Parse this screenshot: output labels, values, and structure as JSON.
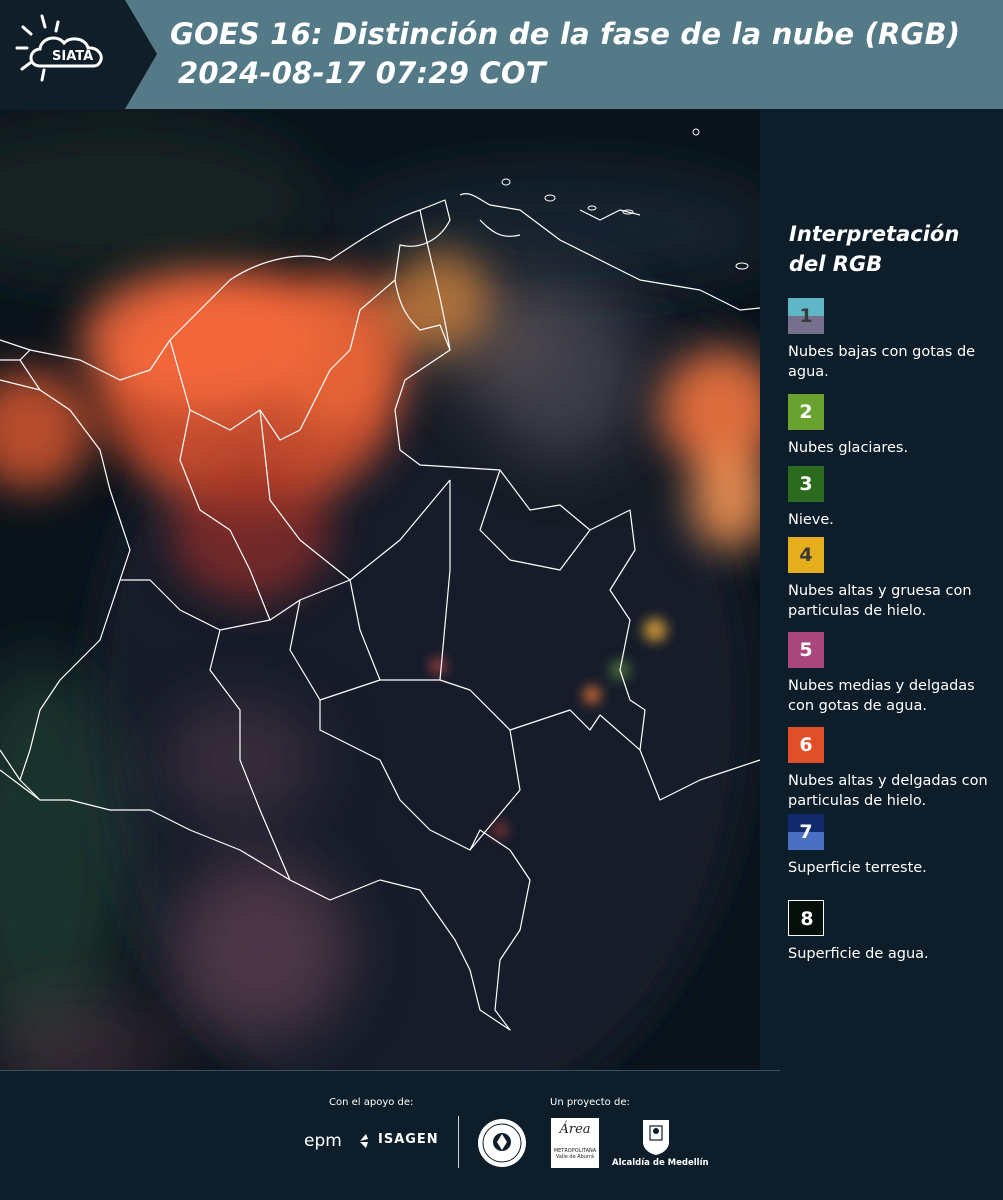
{
  "header": {
    "logo_text": "SIATA",
    "title_line1": "GOES 16: Distinción de la fase de la nube (RGB)",
    "title_line2": "2024-08-17 07:29 COT",
    "background_color": "#557a87"
  },
  "legend": {
    "title_line1": "Interpretación",
    "title_line2": "del RGB",
    "items": [
      {
        "number": "1",
        "label": "Nubes bajas con gotas de agua.",
        "color_top": "#5fb6c7",
        "color_bottom": "#77708c"
      },
      {
        "number": "2",
        "label": "Nubes glaciares.",
        "color_top": "#6aa22f",
        "color_bottom": "#6aa22f"
      },
      {
        "number": "3",
        "label": "Nieve.",
        "color_top": "#2c6a1e",
        "color_bottom": "#2c6a1e"
      },
      {
        "number": "4",
        "label": "Nubes altas y gruesa con particulas de hielo.",
        "color_top": "#e5ae1d",
        "color_bottom": "#e5ae1d"
      },
      {
        "number": "5",
        "label": "Nubes medias y delgadas con gotas de agua.",
        "color_top": "#a9467b",
        "color_bottom": "#a9467b"
      },
      {
        "number": "6",
        "label": "Nubes altas y delgadas con particulas de hielo.",
        "color_top": "#e04f27",
        "color_bottom": "#e04f27"
      },
      {
        "number": "7",
        "label": "Superficie terreste.",
        "color_top": "#112a6b",
        "color_bottom": "#4a6fc3"
      },
      {
        "number": "8",
        "label": "Superficie de agua.",
        "color_top": "#05100a",
        "color_bottom": "#05100a"
      }
    ]
  },
  "footer": {
    "support_label": "Con el apoyo de:",
    "project_label": "Un proyecto de:",
    "epm_label": "epm",
    "isagen_label": "ISAGEN",
    "area_label": "Área",
    "area_sub": "METROPOLITANA Valle de Aburrá",
    "medellin_label": "Alcaldía de Medellín"
  }
}
